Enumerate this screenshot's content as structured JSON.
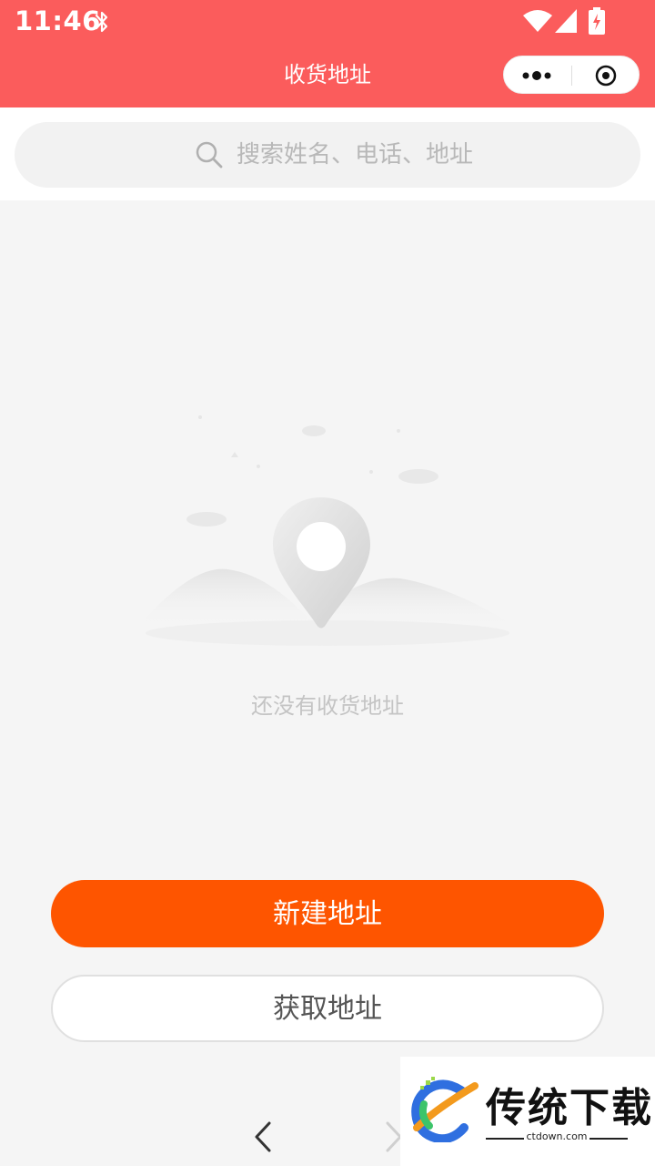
{
  "status_bar": {
    "time": "11:46",
    "icons": [
      "bluetooth-icon",
      "wifi-icon",
      "signal-icon",
      "battery-charging-icon"
    ]
  },
  "nav": {
    "title": "收货地址",
    "capsule_icons": [
      "more-dots-icon",
      "target-icon"
    ]
  },
  "colors": {
    "header_bg": "#fb5c5c",
    "primary_button": "#fe5500",
    "page_bg": "#f5f5f5"
  },
  "search": {
    "placeholder": "搜索姓名、电话、地址",
    "icon": "search-icon"
  },
  "empty_state": {
    "illustration": "map-pin-illustration",
    "message": "还没有收货地址"
  },
  "actions": {
    "new_address": "新建地址",
    "fetch_address": "获取地址"
  },
  "bottom_nav": {
    "icons": [
      "back-arrow-icon",
      "forward-arrow-icon"
    ]
  },
  "watermark": {
    "title": "传统下载",
    "subtitle": "ctdown.com"
  }
}
